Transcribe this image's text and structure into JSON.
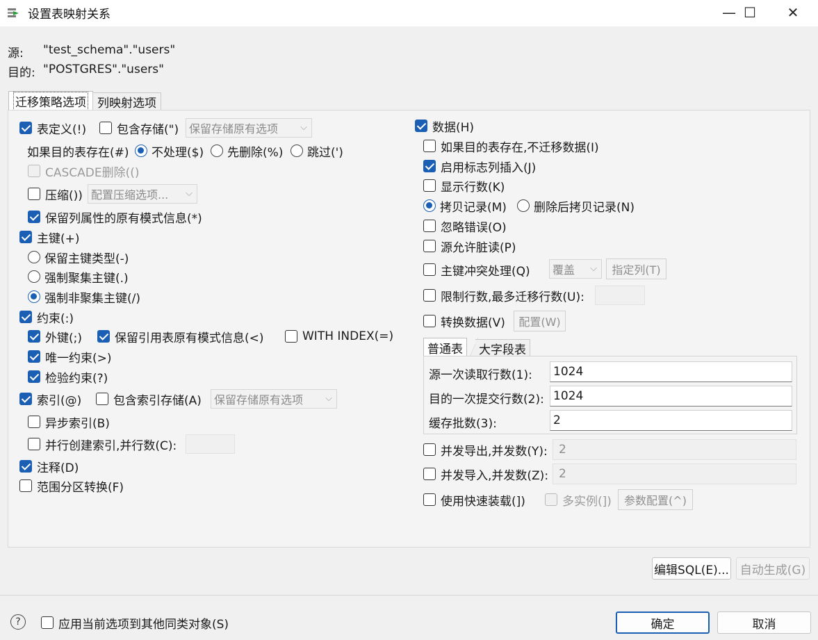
{
  "window": {
    "title": "设置表映射关系",
    "minimize": "—",
    "maximize": "☐",
    "close": "✕"
  },
  "header": {
    "source_label": "源:",
    "source_value": "\"test_schema\".\"users\"",
    "target_label": "目的:",
    "target_value": "\"POSTGRES\".\"users\""
  },
  "tabs": [
    "迁移策略选项",
    "列映射选项"
  ],
  "left": {
    "table_def": "表定义(!)",
    "include_storage": "包含存储(\")",
    "storage_combo": "保留存储原有选项",
    "if_target_exists": "如果目的表存在(#)",
    "no_action": "不处理($)",
    "drop_first": "先删除(%)",
    "skip": "跳过(')",
    "cascade_drop": "CASCADE删除(()",
    "compress": "压缩())",
    "compress_combo": "配置压缩选项...",
    "keep_column_schema": "保留列属性的原有模式信息(*)",
    "primary_key": "主键(+)",
    "keep_pk_type": "保留主键类型(-)",
    "force_clustered": "强制聚集主键(.)",
    "force_nonclustered": "强制非聚集主键(/)",
    "constraints": "约束(:)",
    "foreign_key": "外键(;)",
    "keep_ref_schema": "保留引用表原有模式信息(<)",
    "with_index": "WITH INDEX(=)",
    "unique": "唯一约束(>)",
    "check": "检验约束(?)",
    "index": "索引(@)",
    "include_index_storage": "包含索引存储(A)",
    "index_storage_combo": "保留存储原有选项",
    "async_index": "异步索引(B)",
    "parallel_index": "并行创建索引,并行数(C):",
    "comments": "注释(D)",
    "range_partition": "范围分区转换(F)"
  },
  "right": {
    "data": "数据(H)",
    "skip_if_exists": "如果目的表存在,不迁移数据(I)",
    "identity_insert": "启用标志列插入(J)",
    "show_rows": "显示行数(K)",
    "copy_records": "拷贝记录(M)",
    "delete_then_copy": "删除后拷贝记录(N)",
    "ignore_errors": "忽略错误(O)",
    "dirty_read": "源允许脏读(P)",
    "pk_conflict": "主键冲突处理(Q)",
    "pk_conflict_combo": "覆盖",
    "specify_columns": "指定列(T)",
    "limit_rows": "限制行数,最多迁移行数(U):",
    "transform_data": "转换数据(V)",
    "configure": "配置(W)",
    "subtabs": [
      "普通表",
      "大字段表"
    ],
    "read_rows_label": "源一次读取行数(1):",
    "read_rows_value": "1024",
    "commit_rows_label": "目的一次提交行数(2):",
    "commit_rows_value": "1024",
    "cache_batches_label": "缓存批数(3):",
    "cache_batches_value": "2",
    "concurrent_export": "并发导出,并发数(Y):",
    "concurrent_export_value": "2",
    "concurrent_import": "并发导入,并发数(Z):",
    "concurrent_import_value": "2",
    "fast_load": "使用快速装载(])",
    "multi_instance": "多实例(])",
    "param_config": "参数配置(^)"
  },
  "actions": {
    "edit_sql": "编辑SQL(E)...",
    "auto_generate": "自动生成(G)"
  },
  "footer": {
    "help": "?",
    "apply_to_others": "应用当前选项到其他同类对象(S)",
    "ok": "确定",
    "cancel": "取消"
  },
  "colors": {
    "accent": "#1a5fb4"
  }
}
